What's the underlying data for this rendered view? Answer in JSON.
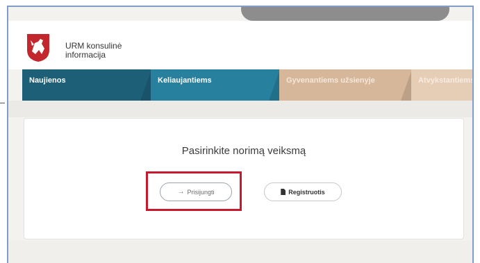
{
  "topbar": {
    "pill_text": ""
  },
  "header": {
    "site_title_line1": "URM konsulinė",
    "site_title_line2": "informacija"
  },
  "nav": {
    "items": [
      {
        "label": "Naujienos"
      },
      {
        "label": "Keliaujantiems"
      },
      {
        "label": "Gyvenantiems užsienyje"
      },
      {
        "label": "Atvykstantiems"
      }
    ]
  },
  "main": {
    "heading": "Pasirinkite norimą veiksmą",
    "login_label": "Prisijungti",
    "register_label": "Registruotis"
  },
  "colors": {
    "highlight": "#c8192c",
    "nav_dark": "#1e5f78",
    "nav_blue": "#26809e",
    "nav_tan": "#d7b79a"
  }
}
